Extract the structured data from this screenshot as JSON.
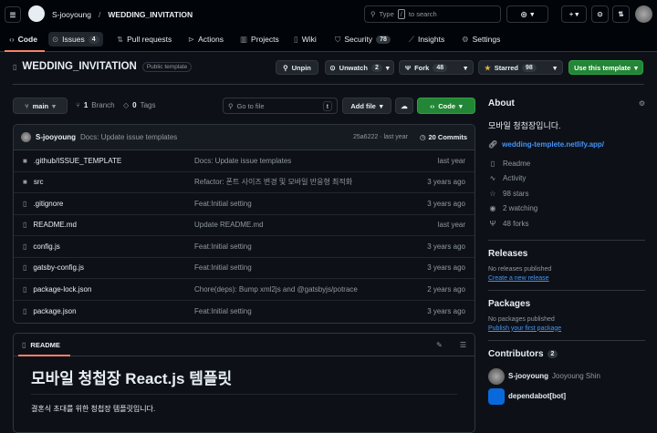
{
  "header": {
    "owner": "S-jooyoung",
    "separator": "/",
    "repo": "WEDDING_INVITATION",
    "search_placeholder_prefix": "Type",
    "search_key": "/",
    "search_placeholder_suffix": "to search"
  },
  "nav": {
    "tabs": [
      {
        "label": "Code",
        "icon": "code-icon",
        "active": true
      },
      {
        "label": "Issues",
        "icon": "issue-icon",
        "count": "4"
      },
      {
        "label": "Pull requests",
        "icon": "pull-request-icon"
      },
      {
        "label": "Actions",
        "icon": "play-icon"
      },
      {
        "label": "Projects",
        "icon": "table-icon"
      },
      {
        "label": "Wiki",
        "icon": "book-icon"
      },
      {
        "label": "Security",
        "icon": "shield-icon",
        "count": "78"
      },
      {
        "label": "Insights",
        "icon": "graph-icon"
      },
      {
        "label": "Settings",
        "icon": "gear-icon"
      }
    ]
  },
  "repo": {
    "name": "WEDDING_INVITATION",
    "visibility": "Public template",
    "unpin": "Unpin",
    "unwatch": "Unwatch",
    "watch_count": "2",
    "fork": "Fork",
    "fork_count": "48",
    "starred": "Starred",
    "star_count": "98",
    "use_template": "Use this template"
  },
  "branchbar": {
    "branch": "main",
    "branches_count": "1",
    "branches_label": "Branch",
    "tags_count": "0",
    "tags_label": "Tags",
    "goto_placeholder": "Go to file",
    "goto_key": "t",
    "add_file": "Add file",
    "code": "Code"
  },
  "commit": {
    "author": "S-jooyoung",
    "message": "Docs: Update issue templates",
    "hash_time": "25a6222 · last year",
    "commits": "20 Commits"
  },
  "files": [
    {
      "name": ".github/ISSUE_TEMPLATE",
      "type": "folder",
      "message": "Docs: Update issue templates",
      "time": "last year"
    },
    {
      "name": "src",
      "type": "folder",
      "message": "Refactor: 폰트 사이즈 변경 및 모바일 반응형 최적화",
      "time": "3 years ago"
    },
    {
      "name": ".gitignore",
      "type": "file",
      "message": "Feat:Initial setting",
      "time": "3 years ago"
    },
    {
      "name": "README.md",
      "type": "file",
      "message": "Update README.md",
      "time": "last year"
    },
    {
      "name": "config.js",
      "type": "file",
      "message": "Feat:Initial setting",
      "time": "3 years ago"
    },
    {
      "name": "gatsby-config.js",
      "type": "file",
      "message": "Feat:Initial setting",
      "time": "3 years ago"
    },
    {
      "name": "package-lock.json",
      "type": "file",
      "message": "Chore(deps): Bump xml2js and @gatsbyjs/potrace",
      "time": "2 years ago"
    },
    {
      "name": "package.json",
      "type": "file",
      "message": "Feat:Initial setting",
      "time": "3 years ago"
    }
  ],
  "readme": {
    "tab": "README",
    "title": "모바일 청첩장 React.js 템플릿",
    "body": "결혼식 초대를 위한 청첩장 템플릿입니다."
  },
  "about": {
    "title": "About",
    "description": "모바일 청첩장입니다.",
    "website": "wedding-templete.netlify.app/",
    "items": [
      {
        "icon": "book-icon",
        "label": "Readme"
      },
      {
        "icon": "pulse-icon",
        "label": "Activity"
      },
      {
        "icon": "star-icon",
        "label": "98 stars"
      },
      {
        "icon": "eye-icon",
        "label": "2 watching"
      },
      {
        "icon": "fork-icon",
        "label": "48 forks"
      }
    ]
  },
  "releases": {
    "title": "Releases",
    "empty": "No releases published",
    "link": "Create a new release"
  },
  "packages": {
    "title": "Packages",
    "empty": "No packages published",
    "link": "Publish your first package"
  },
  "contributors": {
    "title": "Contributors",
    "count": "2",
    "people": [
      {
        "login": "S-jooyoung",
        "name": "Jooyoung Shin"
      },
      {
        "login": "dependabot[bot]",
        "name": ""
      }
    ]
  },
  "colors": {
    "accent_green": "#238636",
    "link": "#4493f8",
    "tab_underline": "#f78166",
    "star": "#e3b341"
  }
}
